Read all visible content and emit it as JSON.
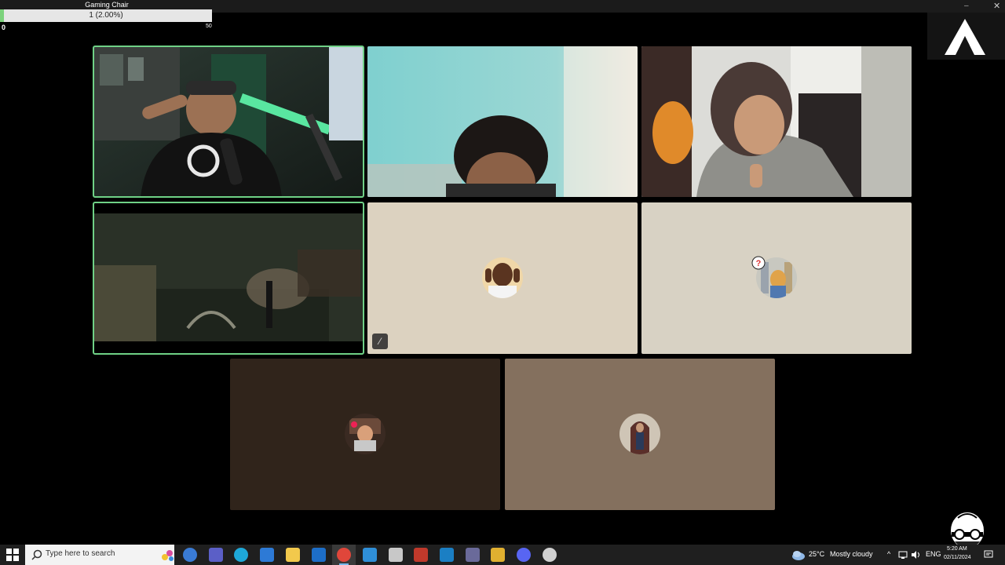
{
  "window": {
    "minimize_glyph": "–",
    "close_glyph": "✕"
  },
  "goal": {
    "title": "Gaming Chair",
    "progress_text": "1 (2.00%)",
    "progress_fraction": 0.02,
    "min_label": "0",
    "max_label": "50"
  },
  "logo": {
    "icon": "a-logo-icon"
  },
  "participants": [
    {
      "id": "p1",
      "kind": "video",
      "speaking": true
    },
    {
      "id": "p2",
      "kind": "video",
      "speaking": false
    },
    {
      "id": "p3",
      "kind": "video",
      "speaking": false
    },
    {
      "id": "p4",
      "kind": "video",
      "speaking": true
    },
    {
      "id": "p5",
      "kind": "avatar",
      "background": "#dcd2c0",
      "muted": true,
      "mute_icon": "mic-off-icon"
    },
    {
      "id": "p6",
      "kind": "avatar",
      "background": "#d8d2c4",
      "muted": false
    },
    {
      "id": "p7",
      "kind": "avatar",
      "background": "#30241b",
      "muted": false
    },
    {
      "id": "p8",
      "kind": "avatar",
      "background": "#84705e",
      "muted": false
    }
  ],
  "mute_glyph": "⁄",
  "taskbar": {
    "search_placeholder": "Type here to search",
    "apps": [
      "copilot-icon",
      "teams-icon",
      "edge-icon",
      "store-icon",
      "file-explorer-icon",
      "outlook-icon",
      "chrome-icon",
      "notes-icon",
      "game-icon",
      "news-icon",
      "steam-icon",
      "capture-icon",
      "winamp-icon",
      "discord-icon",
      "obs-icon"
    ],
    "active_app": "chrome-icon",
    "weather_temp": "25°C",
    "weather_desc": "Mostly cloudy",
    "tray_chevron": "^",
    "language": "ENG",
    "time": "5:20 AM",
    "date": "02/11/2024"
  },
  "colors": {
    "speaking_outline": "#6fd186",
    "goal_fill": "#7cd27c",
    "taskbar_bg": "#1f1f1f"
  }
}
